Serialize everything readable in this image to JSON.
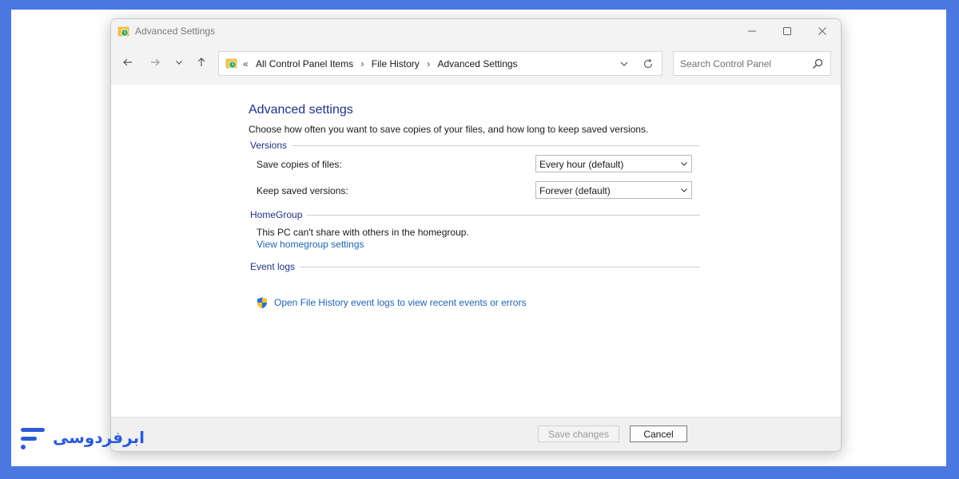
{
  "window": {
    "title": "Advanced Settings"
  },
  "navigation": {
    "breadcrumb_chevrons": "«",
    "breadcrumbs": [
      "All Control Panel Items",
      "File History",
      "Advanced Settings"
    ],
    "search_placeholder": "Search Control Panel"
  },
  "page": {
    "heading": "Advanced settings",
    "description": "Choose how often you want to save copies of your files, and how long to keep saved versions."
  },
  "versions": {
    "group_label": "Versions",
    "save_copies_label": "Save copies of files:",
    "save_copies_value": "Every hour (default)",
    "keep_versions_label": "Keep saved versions:",
    "keep_versions_value": "Forever (default)"
  },
  "homegroup": {
    "group_label": "HomeGroup",
    "status_text": "This PC can't share with others in the homegroup.",
    "link_text": "View homegroup settings"
  },
  "event_logs": {
    "group_label": "Event logs",
    "link_text": "Open File History event logs to view recent events or errors"
  },
  "footer": {
    "save_label": "Save changes",
    "cancel_label": "Cancel"
  },
  "branding": {
    "logo_text": "ابرفردوسی"
  },
  "colors": {
    "frame_background": "#4a78e0",
    "heading": "#1e3287",
    "link": "#1e64b4",
    "logo": "#2b5bd7"
  }
}
